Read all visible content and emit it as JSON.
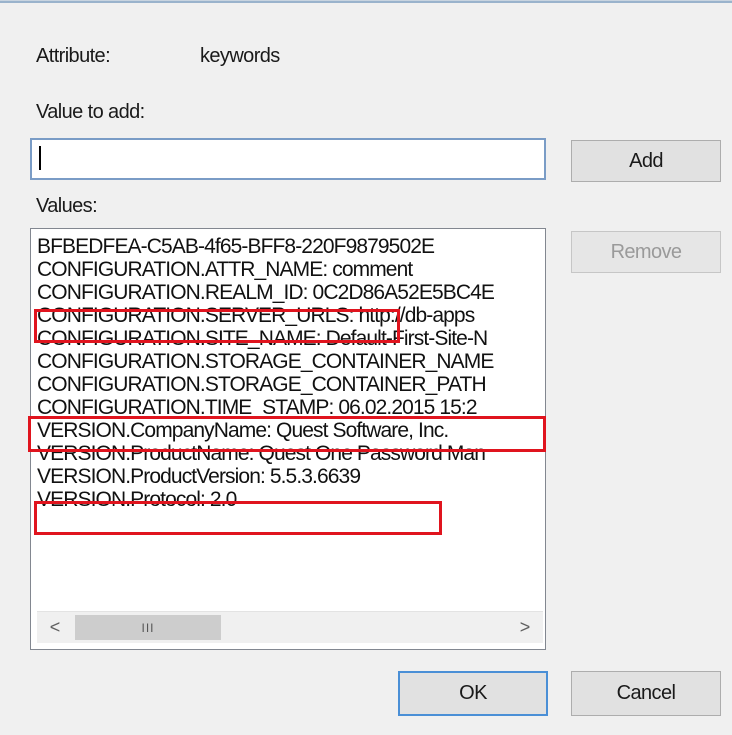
{
  "attribute": {
    "label": "Attribute:",
    "value": "keywords"
  },
  "value_to_add": {
    "label": "Value to add:",
    "value": "",
    "placeholder": ""
  },
  "buttons": {
    "add": "Add",
    "remove": "Remove",
    "ok": "OK",
    "cancel": "Cancel"
  },
  "values": {
    "label": "Values:",
    "items": [
      "BFBEDFEA-C5AB-4f65-BFF8-220F9879502E",
      "CONFIGURATION.ATTR_NAME: comment",
      "CONFIGURATION.REALM_ID: 0C2D86A52E5BC4E",
      "CONFIGURATION.SERVER_URLS: http://db-apps",
      "CONFIGURATION.SITE_NAME: Default-First-Site-N",
      "CONFIGURATION.STORAGE_CONTAINER_NAME",
      "CONFIGURATION.STORAGE_CONTAINER_PATH",
      "CONFIGURATION.TIME_STAMP: 06.02.2015 15:2",
      "VERSION.CompanyName: Quest Software, Inc.",
      "VERSION.ProductName: Quest One Password Man",
      "VERSION.ProductVersion: 5.5.3.6639",
      "VERSION.Protocol: 2.0"
    ]
  },
  "scrollbar": {
    "left_arrow": "<",
    "right_arrow": ">",
    "thumb_grip": "III"
  },
  "colors": {
    "highlight": "#e0141e",
    "focus_border": "#4a8fd6"
  }
}
